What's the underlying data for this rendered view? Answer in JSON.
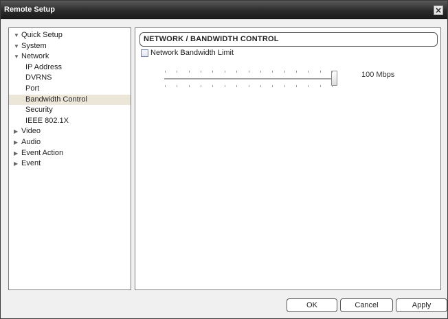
{
  "window": {
    "title": "Remote Setup",
    "close_glyph": "×",
    "close_icon": "close-icon"
  },
  "tree": {
    "items": [
      {
        "label": "Quick Setup",
        "arrow": "▼",
        "level": 0,
        "selected": false
      },
      {
        "label": "System",
        "arrow": "▼",
        "level": 0,
        "selected": false
      },
      {
        "label": "Network",
        "arrow": "▼",
        "level": 0,
        "selected": false
      },
      {
        "label": "IP Address",
        "arrow": "",
        "level": 1,
        "selected": false
      },
      {
        "label": "DVRNS",
        "arrow": "",
        "level": 1,
        "selected": false
      },
      {
        "label": "Port",
        "arrow": "",
        "level": 1,
        "selected": false
      },
      {
        "label": "Bandwidth Control",
        "arrow": "",
        "level": 1,
        "selected": true
      },
      {
        "label": "Security",
        "arrow": "",
        "level": 1,
        "selected": false
      },
      {
        "label": "IEEE 802.1X",
        "arrow": "",
        "level": 1,
        "selected": false
      },
      {
        "label": "Video",
        "arrow": "▶",
        "level": 0,
        "selected": false
      },
      {
        "label": "Audio",
        "arrow": "▶",
        "level": 0,
        "selected": false
      },
      {
        "label": "Event Action",
        "arrow": "▶",
        "level": 0,
        "selected": false
      },
      {
        "label": "Event",
        "arrow": "▶",
        "level": 0,
        "selected": false
      }
    ],
    "selected_color": "#ebe6d8"
  },
  "content": {
    "section_title": "NETWORK / BANDWIDTH CONTROL",
    "bandwidth_limit": {
      "label": "Network Bandwidth Limit",
      "checked": false
    },
    "slider": {
      "value_text": "100 Mbps",
      "level": 1.0
    }
  },
  "buttons": {
    "ok": "OK",
    "cancel": "Cancel",
    "apply": "Apply"
  }
}
